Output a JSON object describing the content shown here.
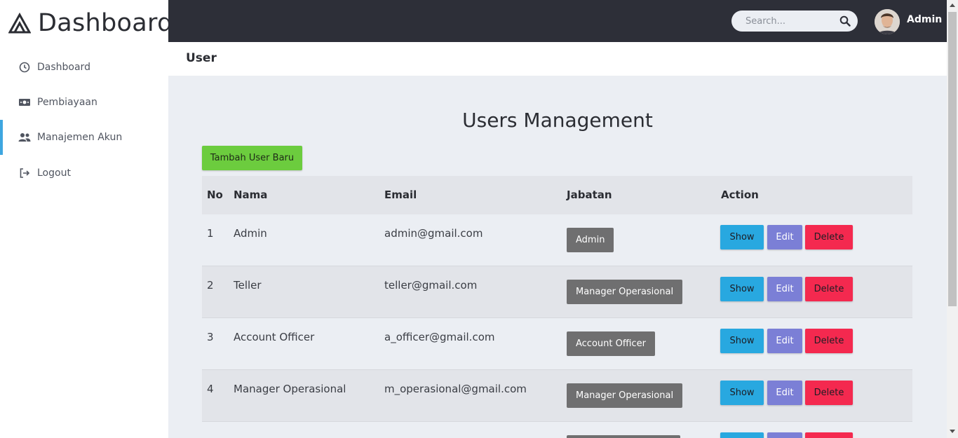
{
  "sidebar": {
    "brand": "Dashboard",
    "items": [
      {
        "label": "Dashboard",
        "icon": "clock-icon"
      },
      {
        "label": "Pembiayaan",
        "icon": "money-icon"
      },
      {
        "label": "Manajemen Akun",
        "icon": "users-icon",
        "active": true
      },
      {
        "label": "Logout",
        "icon": "logout-icon"
      }
    ]
  },
  "topbar": {
    "search_placeholder": "Search...",
    "user_name": "Admin"
  },
  "page": {
    "header_title": "User",
    "title": "Users Management",
    "add_button": "Tambah User Baru"
  },
  "table": {
    "headers": [
      "No",
      "Nama",
      "Email",
      "Jabatan",
      "Action"
    ],
    "rows": [
      {
        "no": "1",
        "nama": "Admin",
        "email": "admin@gmail.com",
        "jabatan": "Admin"
      },
      {
        "no": "2",
        "nama": "Teller",
        "email": "teller@gmail.com",
        "jabatan": "Manager Operasional"
      },
      {
        "no": "3",
        "nama": "Account Officer",
        "email": "a_officer@gmail.com",
        "jabatan": "Account Officer"
      },
      {
        "no": "4",
        "nama": "Manager Operasional",
        "email": "m_operasional@gmail.com",
        "jabatan": "Manager Operasional"
      }
    ],
    "actions": {
      "show": "Show",
      "edit": "Edit",
      "delete": "Delete"
    }
  },
  "colors": {
    "sidebar_active": "#3ea6e0",
    "topbar_bg": "#2d2f38",
    "add_button": "#6ccc3e",
    "show_button": "#28a8e0",
    "edit_button": "#7b7fd6",
    "delete_button": "#f4294f",
    "badge": "#6f6f70"
  }
}
